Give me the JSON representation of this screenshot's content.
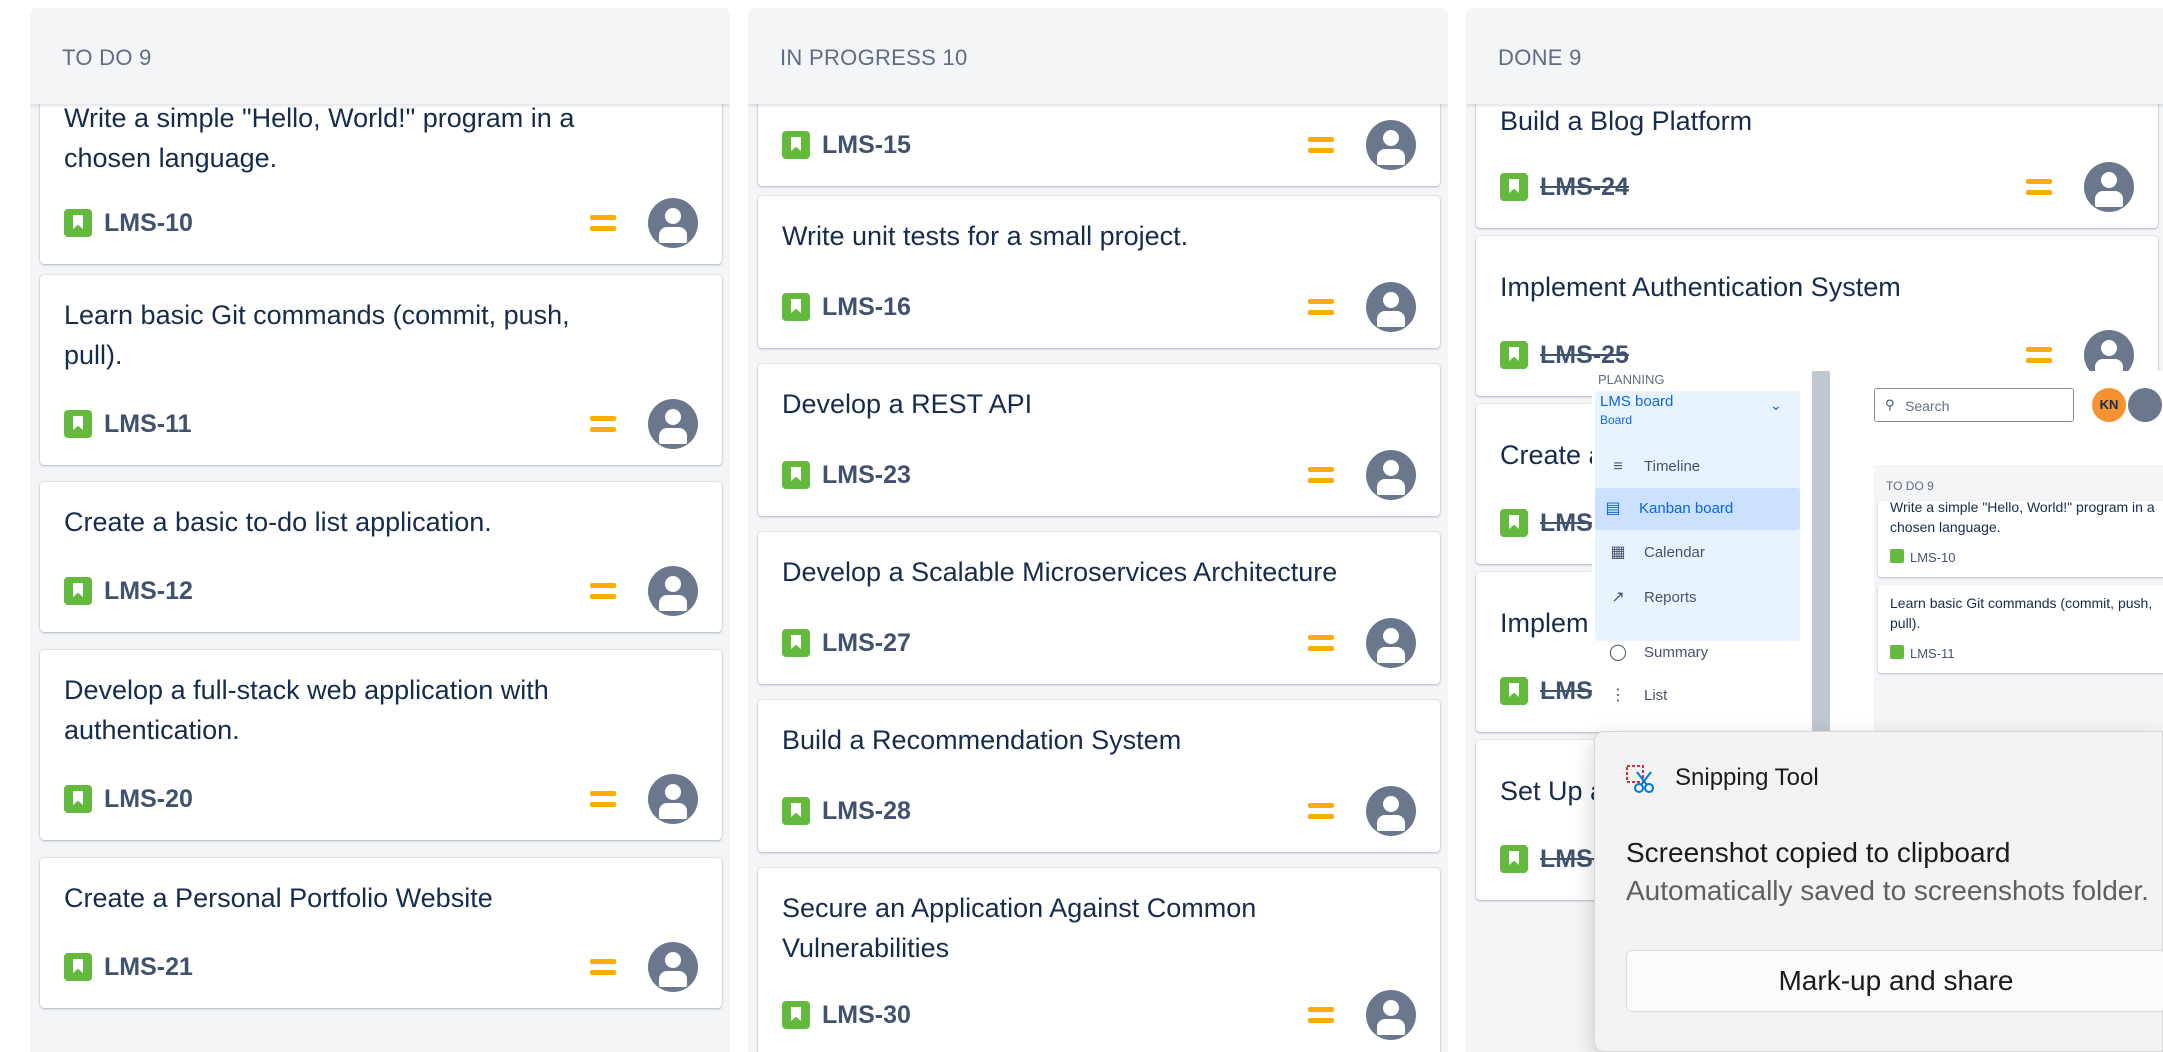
{
  "columns": [
    {
      "header": "TO DO 9",
      "cards": [
        {
          "title": "Write a simple \"Hello, World!\" program in a chosen language.",
          "key": "LMS-10",
          "done": false
        },
        {
          "title": "Learn basic Git commands (commit, push, pull).",
          "key": "LMS-11",
          "done": false
        },
        {
          "title": "Create a basic to-do list application.",
          "key": "LMS-12",
          "done": false
        },
        {
          "title": "Develop a full-stack web application with authentication.",
          "key": "LMS-20",
          "done": false
        },
        {
          "title": "Create a Personal Portfolio Website",
          "key": "LMS-21",
          "done": false
        }
      ]
    },
    {
      "header": "IN PROGRESS 10",
      "cards": [
        {
          "title": "",
          "key": "LMS-15",
          "done": false
        },
        {
          "title": "Write unit tests for a small project.",
          "key": "LMS-16",
          "done": false
        },
        {
          "title": "Develop a REST API",
          "key": "LMS-23",
          "done": false
        },
        {
          "title": "Develop a Scalable Microservices Architecture",
          "key": "LMS-27",
          "done": false
        },
        {
          "title": "Build a Recommendation System",
          "key": "LMS-28",
          "done": false
        },
        {
          "title": "Secure an Application Against Common Vulnerabilities",
          "key": "LMS-30",
          "done": false
        }
      ]
    },
    {
      "header": "DONE 9",
      "cards": [
        {
          "title": "Build a Blog Platform",
          "key": "LMS-24",
          "done": true
        },
        {
          "title": "Implement Authentication System",
          "key": "LMS-25",
          "done": true
        },
        {
          "title": "Create a",
          "key": "LMS-",
          "done": true
        },
        {
          "title": "Implem",
          "key": "LMS-",
          "done": true
        },
        {
          "title": "Set Up a",
          "key": "LMS-",
          "done": true
        }
      ]
    }
  ],
  "preview": {
    "section_label": "PLANNING",
    "board_name": "LMS board",
    "board_sub": "Board",
    "nav": [
      {
        "label": "Timeline",
        "icon": "timeline-icon",
        "active": false
      },
      {
        "label": "Kanban board",
        "icon": "kanban-icon",
        "active": true
      },
      {
        "label": "Calendar",
        "icon": "calendar-icon",
        "active": false
      },
      {
        "label": "Reports",
        "icon": "reports-icon",
        "active": false
      },
      {
        "label": "Summary",
        "icon": "globe-icon",
        "active": false
      },
      {
        "label": "List",
        "icon": "list-icon",
        "active": false
      }
    ],
    "search_placeholder": "Search",
    "avatar_initials": "KN",
    "mini_column_header": "TO DO 9",
    "mini_cards": [
      {
        "title": "Write a simple \"Hello, World!\" program in a chosen language.",
        "key": "LMS-10"
      },
      {
        "title": "Learn basic Git commands (commit, push, pull).",
        "key": "LMS-11"
      }
    ]
  },
  "toast": {
    "app_name": "Snipping Tool",
    "heading": "Screenshot copied to clipboard",
    "subtext": "Automatically saved to screenshots folder.",
    "button": "Mark-up and share"
  },
  "colors": {
    "story": "#63ba3c",
    "priority_medium": "#ffab00",
    "column_bg": "#f4f5f7",
    "accent_blue": "#0c66e4"
  }
}
